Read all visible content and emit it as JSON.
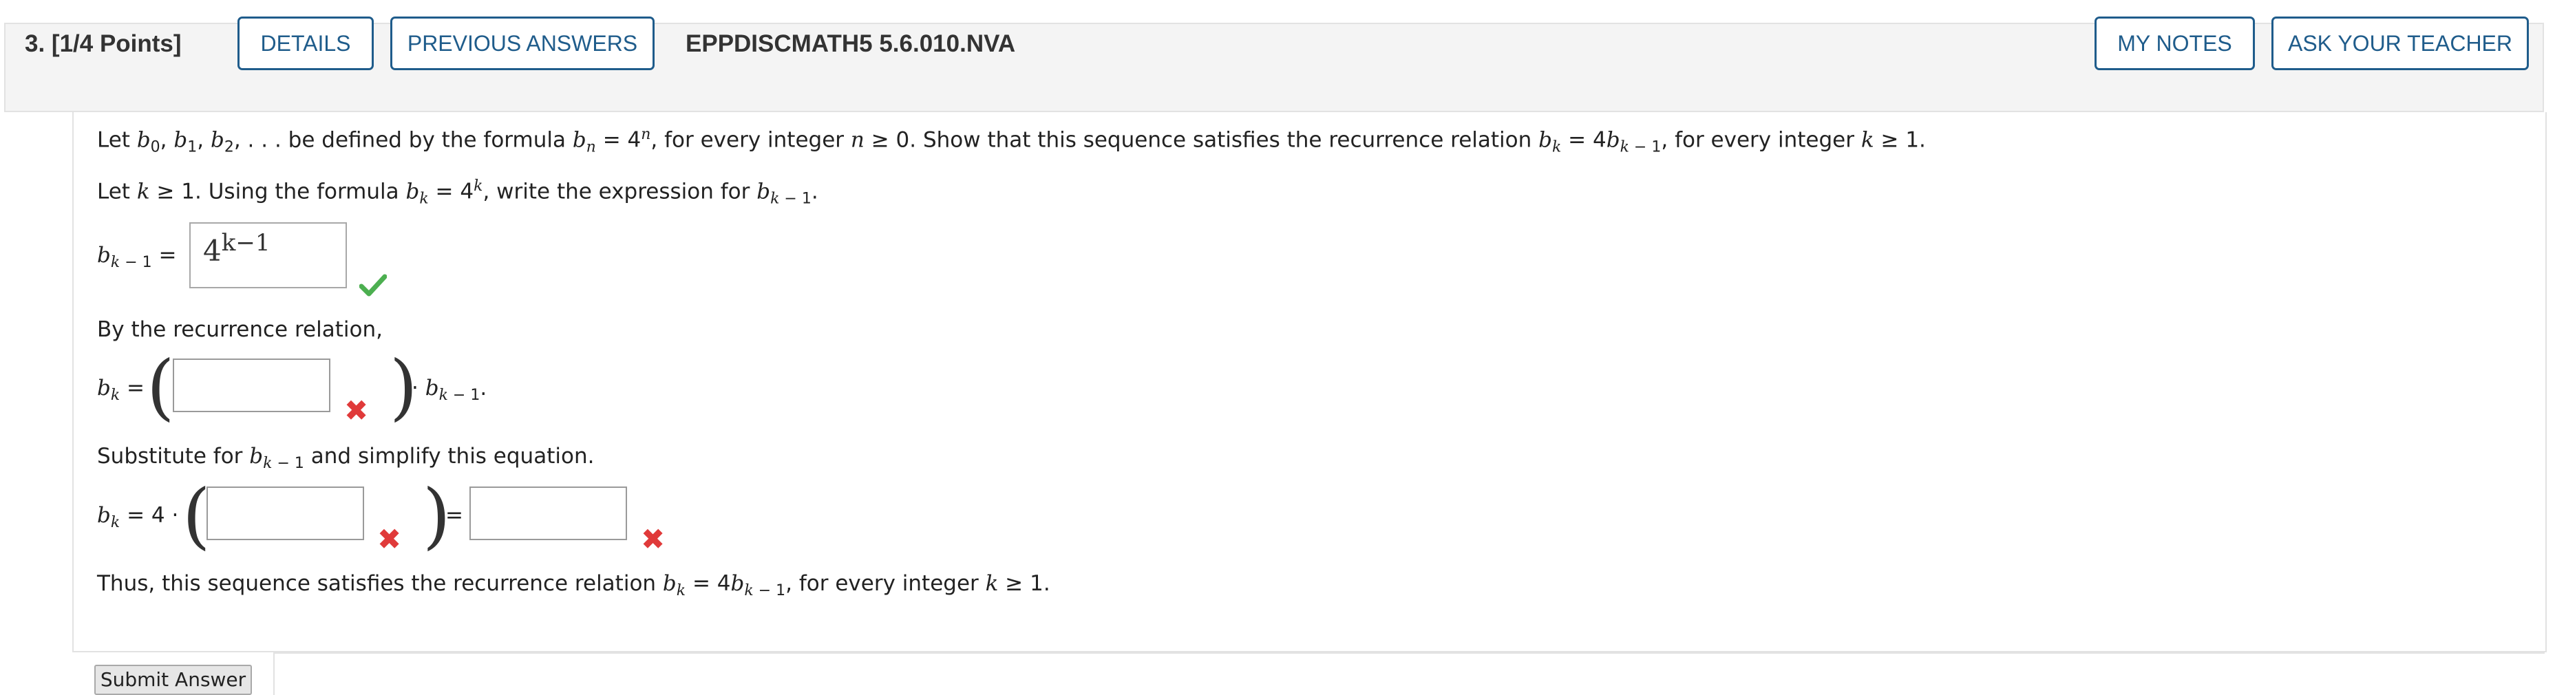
{
  "header": {
    "question_label": "3. [1/4 Points]",
    "details_btn": "DETAILS",
    "prev_answers_btn": "PREVIOUS ANSWERS",
    "assignment_code": "EPPDISCMATH5 5.6.010.NVA",
    "my_notes_btn": "MY NOTES",
    "ask_teacher_btn": "ASK YOUR TEACHER"
  },
  "problem": {
    "intro_prefix": "Let",
    "intro_mid": "be defined by the formula",
    "intro_for_every_n": ", for every integer",
    "intro_show": "≥ 0. Show that this sequence satisfies the recurrence relation",
    "intro_for_every_k": ", for every integer",
    "ge1": "≥ 1.",
    "step1_prefix": "Let",
    "step1_mid": "≥ 1. Using the formula",
    "step1_suffix": ", write the expression for",
    "answer1_value": "4",
    "answer1_exp": "k−1",
    "step2": "By the recurrence relation,",
    "step3_prefix": "Substitute for",
    "step3_suffix": "and simplify this equation.",
    "step4_coef": "= 4 ·",
    "conclusion_prefix": "Thus, this sequence satisfies the recurrence relation",
    "conclusion_mid": ", for every integer",
    "answer2_value": "",
    "answer3_value": "",
    "answer4_value": ""
  },
  "status": {
    "correct_icon": "checkmark-icon",
    "incorrect_icon": "x-mark-icon",
    "correct_color": "#4caf50",
    "incorrect_color": "#e03a3a",
    "accent_color": "#1f5c8b"
  },
  "footer": {
    "submit_btn": "Submit Answer"
  }
}
